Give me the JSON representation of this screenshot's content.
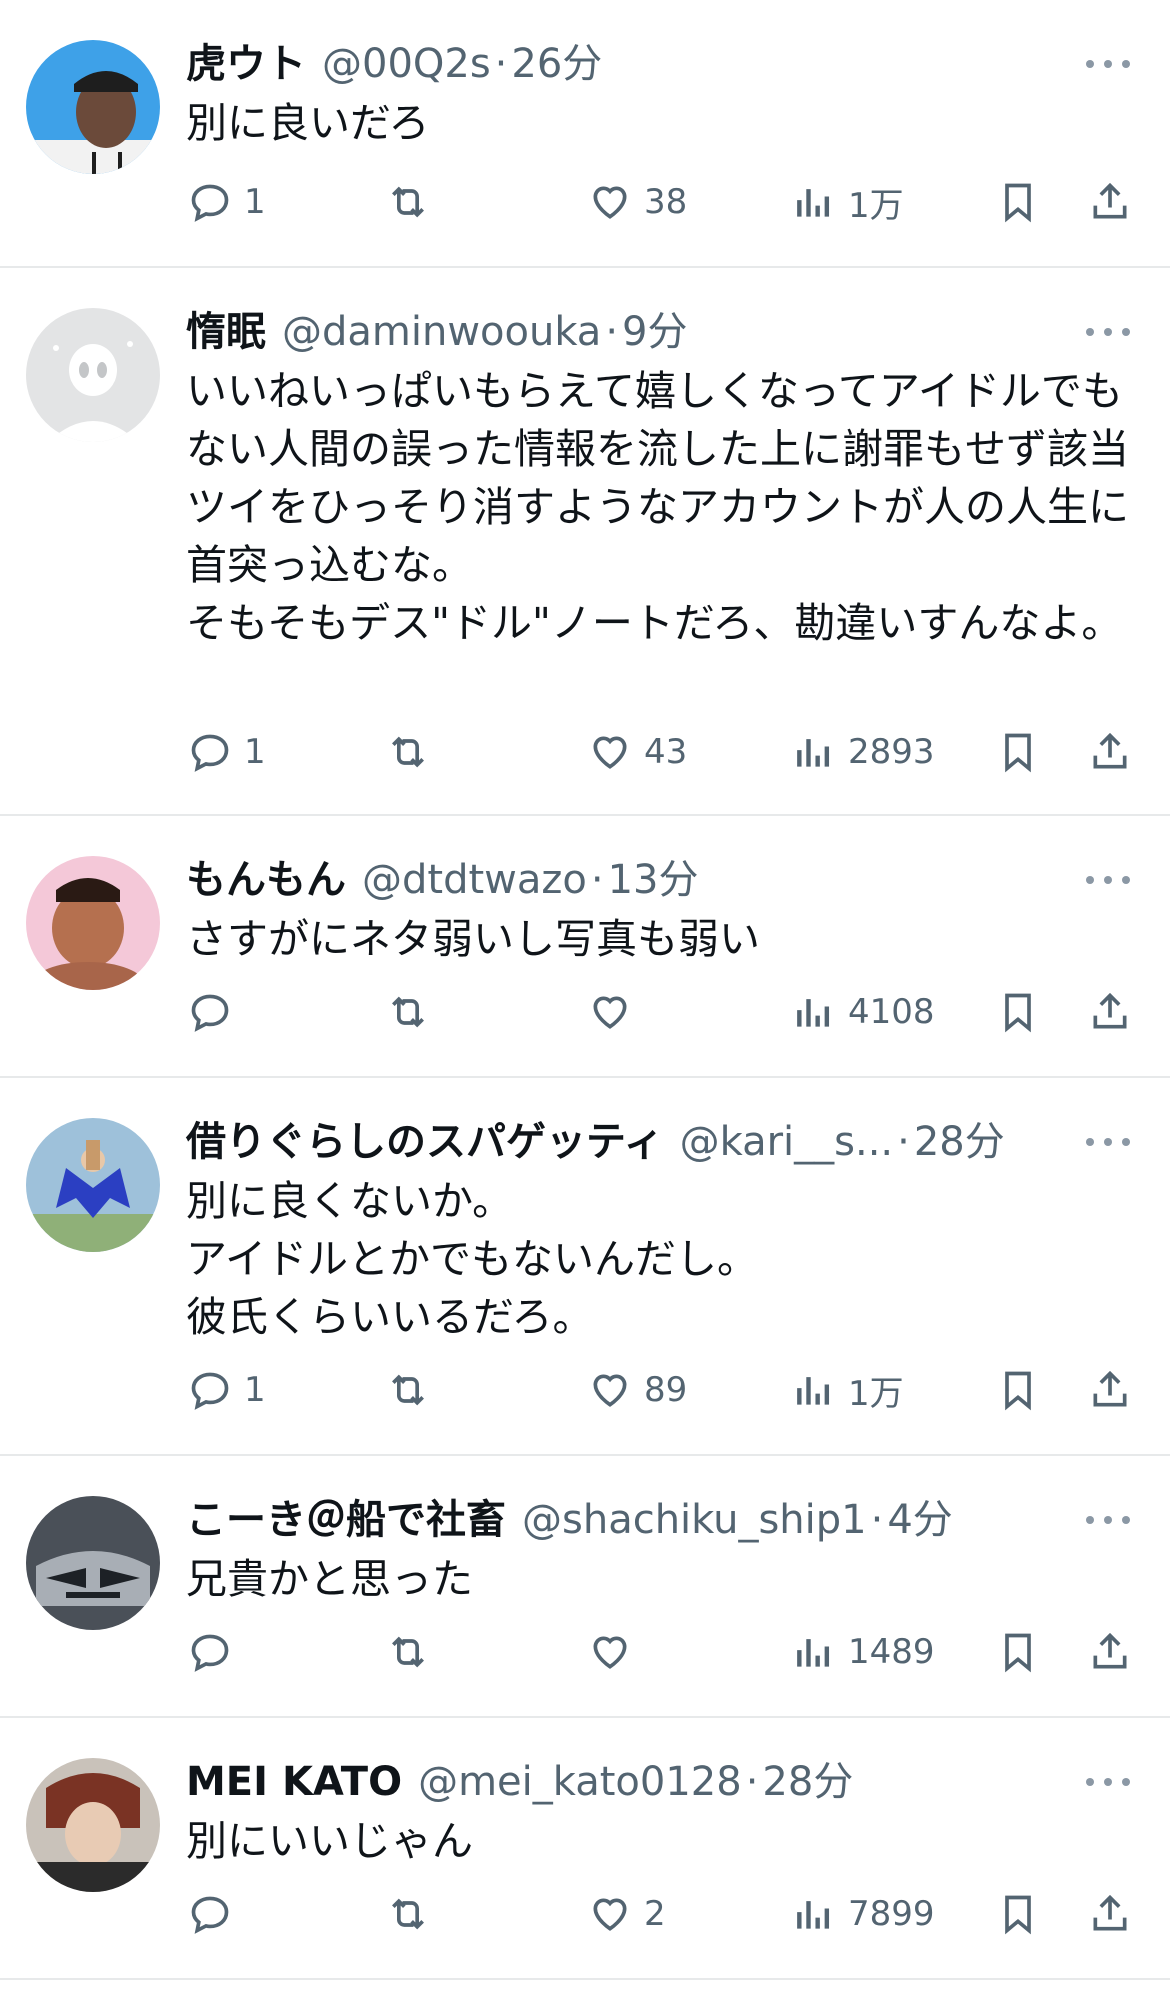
{
  "tweets": [
    {
      "name": "虎ウト",
      "handle": "@00Q2s",
      "time": "26分",
      "text": "別に良いだろ",
      "replies": "1",
      "retweets": "",
      "likes": "38",
      "views": "1万",
      "avatar_colors": [
        "#3ea1e8",
        "#6b4a3a",
        "#1e1e1e"
      ]
    },
    {
      "name": "惰眠",
      "handle": "@daminwoouka",
      "time": "9分",
      "text": "いいねいっぱいもらえて嬉しくなってアイドルでもない人間の誤った情報を流した上に謝罪もせず該当ツイをひっそり消すようなアカウントが人の人生に首突っ込むな。\nそもそもデス\"ドル\"ノートだろ、勘違いすんなよ。",
      "replies": "1",
      "retweets": "",
      "likes": "43",
      "views": "2893",
      "avatar_colors": [
        "#e3e4e5",
        "#c4c6c8",
        "#ffffff"
      ]
    },
    {
      "name": "もんもん",
      "handle": "@dtdtwazo",
      "time": "13分",
      "text": "さすがにネタ弱いし写真も弱い",
      "replies": "",
      "retweets": "",
      "likes": "",
      "views": "4108",
      "avatar_colors": [
        "#f4c8d8",
        "#b5704f",
        "#2a1a14"
      ]
    },
    {
      "name": "借りぐらしのスパゲッティ",
      "handle": "@kari__s...",
      "time": "28分",
      "text": "別に良くないか。\nアイドルとかでもないんだし。\n彼氏くらいいるだろ。",
      "replies": "1",
      "retweets": "",
      "likes": "89",
      "views": "1万",
      "avatar_colors": [
        "#9ec1da",
        "#2b3fc2",
        "#e8c8a8"
      ]
    },
    {
      "name": "こーき＠船で社畜",
      "handle": "@shachiku_ship1",
      "time": "4分",
      "text": "兄貴かと思った",
      "replies": "",
      "retweets": "",
      "likes": "",
      "views": "1489",
      "avatar_colors": [
        "#4a5058",
        "#a8aeb5",
        "#1d2126"
      ]
    },
    {
      "name": "MEI KATO",
      "handle": "@mei_kato0128",
      "time": "28分",
      "text": "別にいいじゃん",
      "replies": "",
      "retweets": "",
      "likes": "2",
      "views": "7899",
      "avatar_colors": [
        "#c9c2ba",
        "#7a3324",
        "#2b2b2b"
      ]
    }
  ]
}
